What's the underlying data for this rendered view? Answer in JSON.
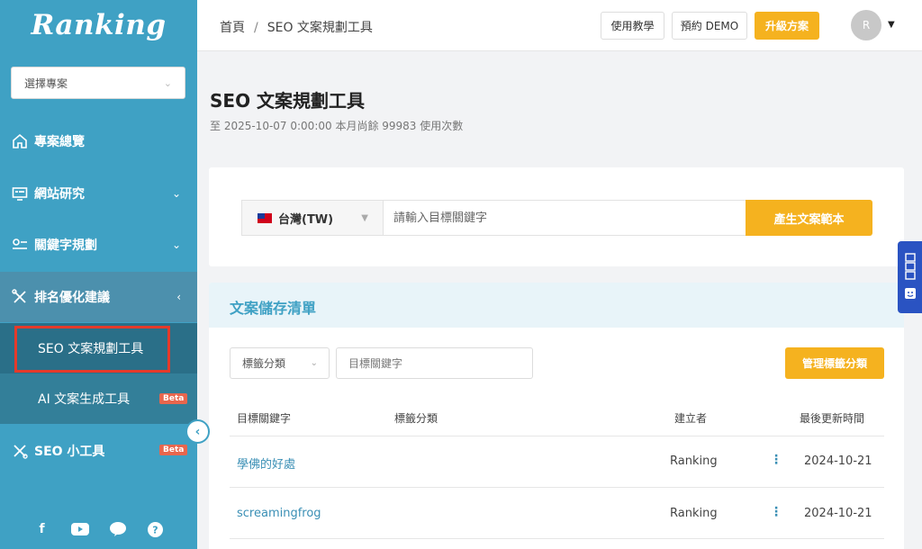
{
  "sidebar": {
    "logo": "Ranking",
    "project_select": {
      "placeholder": "選擇專案"
    },
    "items": [
      {
        "label": "專案總覽",
        "icon": "home-icon"
      },
      {
        "label": "網站研究",
        "icon": "monitor-icon"
      },
      {
        "label": "關鍵字規劃",
        "icon": "keyword-icon"
      },
      {
        "label": "排名優化建議",
        "icon": "tools-icon"
      },
      {
        "label": "SEO 小工具",
        "icon": "wrench-icon",
        "badge": "Beta"
      }
    ],
    "subitems": [
      {
        "label": "SEO 文案規劃工具",
        "active": true
      },
      {
        "label": "AI 文案生成工具",
        "badge": "Beta"
      }
    ],
    "socials": [
      "facebook-icon",
      "youtube-icon",
      "line-icon",
      "help-icon"
    ]
  },
  "header": {
    "breadcrumb": {
      "home": "首頁",
      "sep": "/",
      "current": "SEO 文案規劃工具"
    },
    "buttons": {
      "tutorial": "使用教學",
      "demo": "預約 DEMO",
      "upgrade": "升級方案"
    },
    "avatar": "R"
  },
  "main": {
    "title": "SEO 文案規劃工具",
    "subtitle": "至 2025-10-07 0:00:00 本月尚餘 99983 使用次數",
    "generator": {
      "country": "台灣(TW)",
      "keyword_placeholder": "請輸入目標關鍵字",
      "generate_label": "產生文案範本"
    },
    "saved_list": {
      "title": "文案儲存清單",
      "tag_filter": "標籤分類",
      "keyword_placeholder": "目標關鍵字",
      "manage_label": "管理標籤分類",
      "columns": [
        "目標關鍵字",
        "標籤分類",
        "建立者",
        "最後更新時間"
      ],
      "rows": [
        {
          "keyword": "學佛的好處",
          "tag": "",
          "creator": "Ranking",
          "updated": "2024-10-21"
        },
        {
          "keyword": "screamingfrog",
          "tag": "",
          "creator": "Ranking",
          "updated": "2024-10-21"
        }
      ]
    }
  },
  "colors": {
    "sidebar": "#3fa1c4",
    "accent": "#f5b21f",
    "link": "#3a8fb5",
    "highlight": "#e53a2a"
  }
}
